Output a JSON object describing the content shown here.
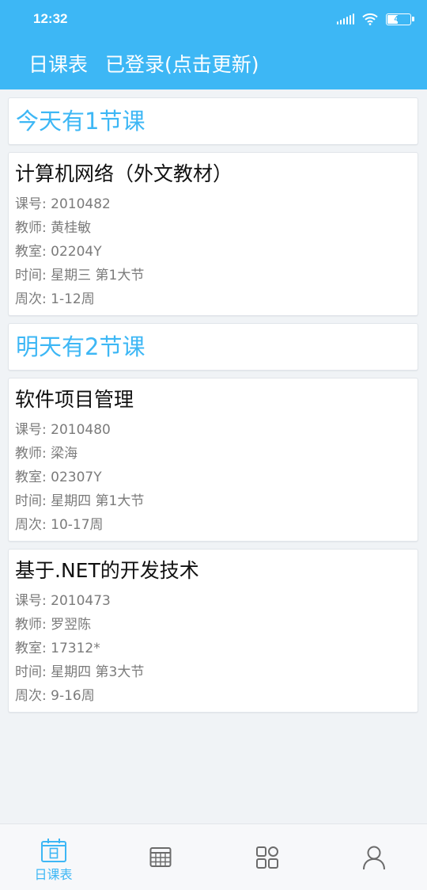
{
  "status_bar": {
    "time": "12:32",
    "battery": "42",
    "battery_level": 0.42
  },
  "app_bar": {
    "title": "日课表",
    "login_status": "已登录(点击更新)"
  },
  "sections": [
    {
      "header": "今天有1节课",
      "courses": [
        {
          "name": "计算机网络（外文教材）",
          "code": "课号: 2010482",
          "teacher": "教师: 黄桂敏",
          "room": "教室: 02204Y",
          "time": "时间: 星期三 第1大节",
          "weeks": "周次: 1-12周"
        }
      ]
    },
    {
      "header": "明天有2节课",
      "courses": [
        {
          "name": "软件项目管理",
          "code": "课号: 2010480",
          "teacher": "教师: 梁海",
          "room": "教室: 02307Y",
          "time": "时间: 星期四 第1大节",
          "weeks": "周次: 10-17周"
        },
        {
          "name": "基于.NET的开发技术",
          "code": "课号: 2010473",
          "teacher": "教师: 罗翌陈",
          "room": "教室: 17312*",
          "time": "时间: 星期四 第3大节",
          "weeks": "周次: 9-16周"
        }
      ]
    }
  ],
  "tab_bar": {
    "active_color": "#3db7f5",
    "inactive_color": "#6b6b6b",
    "tabs": [
      {
        "label": "日课表",
        "icon": "calendar-day-icon",
        "active": true
      },
      {
        "label": "",
        "icon": "table-grid-icon",
        "active": false
      },
      {
        "label": "",
        "icon": "apps-grid-icon",
        "active": false
      },
      {
        "label": "",
        "icon": "person-icon",
        "active": false
      }
    ]
  },
  "colors": {
    "primary": "#3db7f5",
    "background": "#f0f3f6",
    "secondary_text": "#7b7b7b"
  }
}
